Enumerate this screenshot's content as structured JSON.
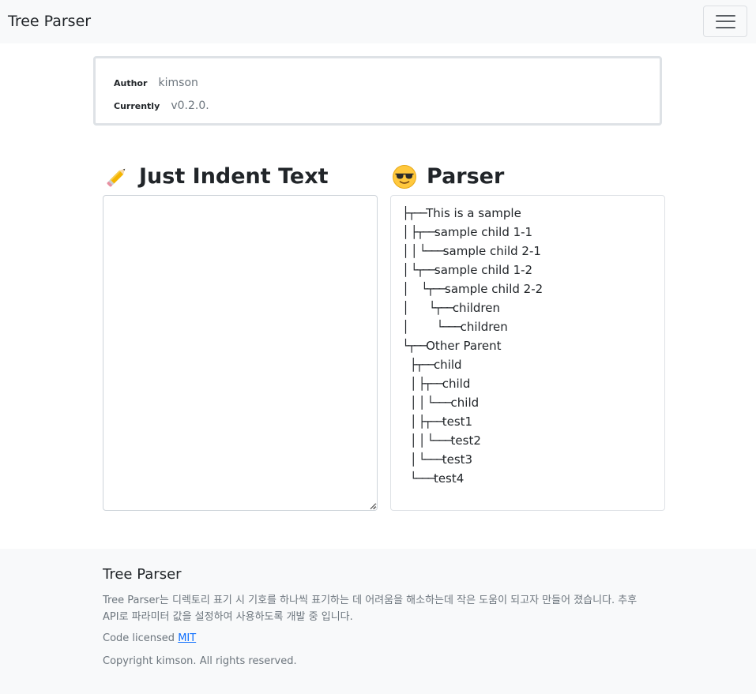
{
  "navbar": {
    "brand": "Tree Parser",
    "toggler_icon": "hamburger-menu-icon"
  },
  "info": {
    "author_label": "Author",
    "author_value": "kimson",
    "version_label": "Currently",
    "version_value": "v0.2.0."
  },
  "left_panel": {
    "icon": "pencil-icon",
    "title": "Just Indent Text",
    "textarea_value": ""
  },
  "right_panel": {
    "icon": "sunglasses-face-icon",
    "title": "Parser",
    "tree": [
      {
        "prefix": "├┬──",
        "text": "This is a sample"
      },
      {
        "prefix": "│ ├┬──",
        "text": "sample child 1-1"
      },
      {
        "prefix": "│ │ └───",
        "text": "sample child 2-1"
      },
      {
        "prefix": "│ └┬──",
        "text": "sample child 1-2"
      },
      {
        "prefix": "│     └┬──",
        "text": "sample child 2-2"
      },
      {
        "prefix": "│        └┬──",
        "text": "children"
      },
      {
        "prefix": "│           └───",
        "text": "children"
      },
      {
        "prefix": "└┬──",
        "text": "Other Parent"
      },
      {
        "prefix": "   ├┬──",
        "text": "child"
      },
      {
        "prefix": "   │ ├┬──",
        "text": "child"
      },
      {
        "prefix": "   │ │ └───",
        "text": "child"
      },
      {
        "prefix": "   │ ├┬──",
        "text": "test1"
      },
      {
        "prefix": "   │ │ └───",
        "text": "test2"
      },
      {
        "prefix": "   │ └───",
        "text": "test3"
      },
      {
        "prefix": "   └───",
        "text": "test4"
      }
    ]
  },
  "footer": {
    "title": "Tree Parser",
    "description": "Tree Parser는 디렉토리 표기 시 기호를 하나씩 표기하는 데 어려움을 해소하는데 작은 도움이 되고자 만들어 졌습니다. 추후 API로 파라미터 값을 설정하여 사용하도록 개발 중 입니다.",
    "license_prefix": "Code licensed",
    "license_link": "MIT",
    "copyright": "Copyright kimson. All rights reserved."
  },
  "colors": {
    "navbar_bg": "#f8f9fa",
    "muted_text": "#6c757d",
    "link": "#0d6efd",
    "border": "#dee2e6"
  }
}
